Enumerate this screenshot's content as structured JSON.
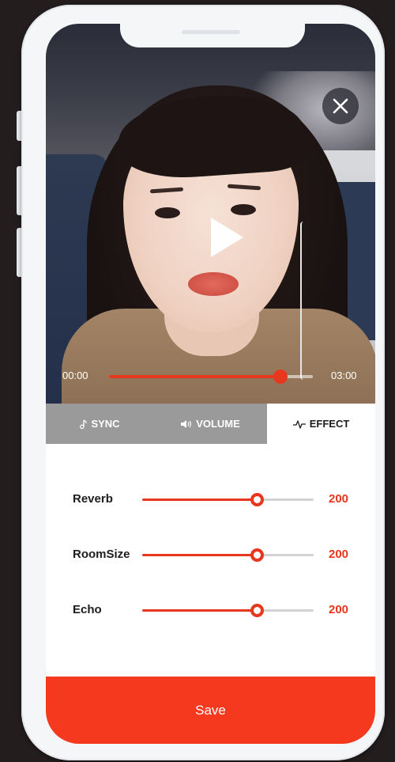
{
  "player": {
    "time_current": "00:00",
    "time_total": "03:00",
    "progress": 0.84
  },
  "tabs": [
    {
      "label": "SYNC",
      "icon": "music-note-icon",
      "active": false
    },
    {
      "label": "VOLUME",
      "icon": "speaker-icon",
      "active": false
    },
    {
      "label": "EFFECT",
      "icon": "waveform-icon",
      "active": true
    }
  ],
  "effects": [
    {
      "label": "Reverb",
      "value": "200",
      "level": 0.67
    },
    {
      "label": "RoomSize",
      "value": "200",
      "level": 0.67
    },
    {
      "label": "Echo",
      "value": "200",
      "level": 0.67
    }
  ],
  "save_label": "Save",
  "colors": {
    "accent": "#e8371f",
    "tab_inactive": "#9a9a9a",
    "save_button": "#f5391e"
  }
}
